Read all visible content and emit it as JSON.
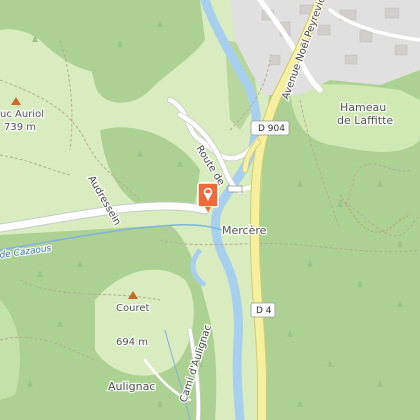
{
  "map": {
    "colors": {
      "meadow": "#d8ecbf",
      "forest": "#add193",
      "urban": "#e0e0e0",
      "water": "#a8d0ee",
      "water_line": "#7fb3dd",
      "road_yellow": "#f4f0a0",
      "road_white": "#ffffff",
      "marker": "#ef6a3b"
    },
    "places": {
      "hameau_line1": "Hameau",
      "hameau_line2": "de Laffitte",
      "mercere": "Mercère",
      "aulignac": "Aulignac"
    },
    "peaks": {
      "auriol_name": "uc Auriol",
      "auriol_elev": "739 m",
      "couret_name": "Couret",
      "couret_elev": "694 m"
    },
    "roads": {
      "route_de": "Route de",
      "avenue": "Avenue Noël Peyrevidal",
      "d904": "D 904",
      "d4": "D 4",
      "cami": "Cami d'Aulignac"
    },
    "water": {
      "stream": "de Cazaous"
    },
    "localities": {
      "audressein": "Audressein"
    },
    "icons": {
      "peak": "triangle-peak-icon",
      "marker": "map-pin-marker-icon"
    }
  }
}
